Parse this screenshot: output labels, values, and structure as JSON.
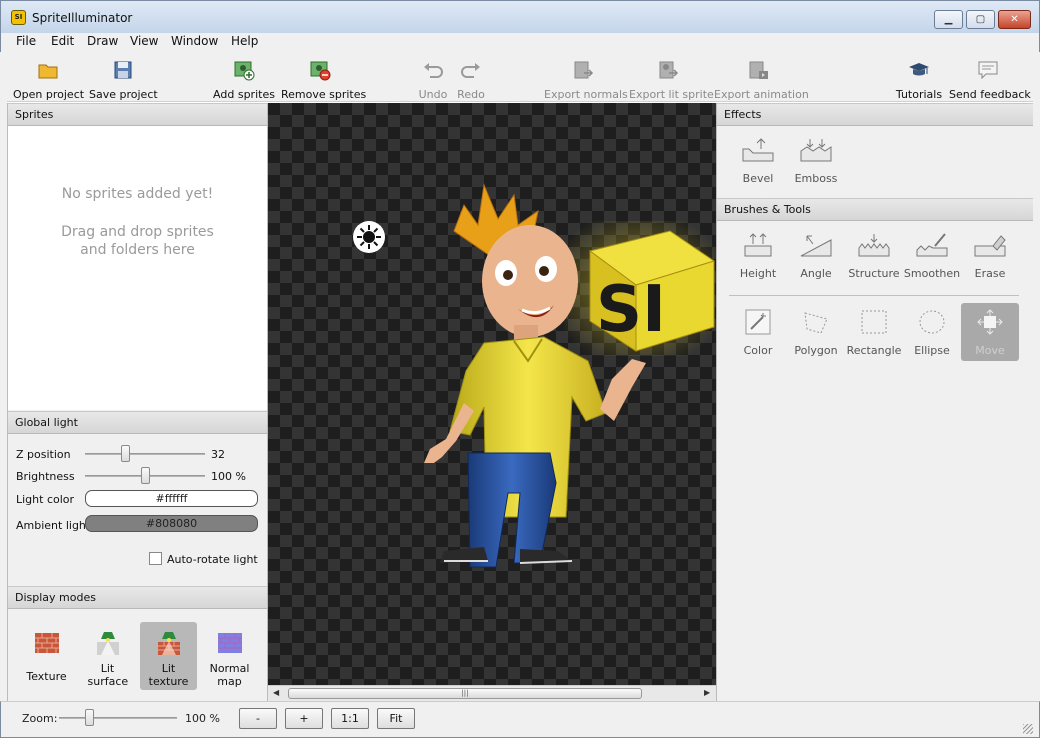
{
  "window": {
    "title": "SpriteIlluminator",
    "icon_text": "SI"
  },
  "menu": [
    "File",
    "Edit",
    "Draw",
    "View",
    "Window",
    "Help"
  ],
  "toolbar": {
    "open_project": "Open project",
    "save_project": "Save project",
    "add_sprites": "Add sprites",
    "remove_sprites": "Remove sprites",
    "undo": "Undo",
    "redo": "Redo",
    "export_normals": "Export normals",
    "export_lit_sprite": "Export lit sprite",
    "export_animation": "Export animation",
    "tutorials": "Tutorials",
    "send_feedback": "Send feedback"
  },
  "sprites": {
    "header": "Sprites",
    "empty_line1": "No sprites added yet!",
    "empty_line2": "Drag and drop sprites and folders here"
  },
  "global_light": {
    "header": "Global light",
    "z_label": "Z position",
    "z_value": "32",
    "z_fraction": 0.33,
    "brightness_label": "Brightness",
    "brightness_value": "100 %",
    "brightness_fraction": 0.5,
    "light_color_label": "Light color",
    "light_color": "#ffffff",
    "ambient_label": "Ambient light",
    "ambient_color": "#808080",
    "autorotate_label": "Auto-rotate light"
  },
  "display_modes": {
    "header": "Display modes",
    "items": [
      "Texture",
      "Lit surface",
      "Lit texture",
      "Normal map"
    ],
    "active_index": 2
  },
  "effects": {
    "header": "Effects",
    "items": [
      "Bevel",
      "Emboss"
    ]
  },
  "brushes": {
    "header": "Brushes & Tools",
    "row1": [
      "Height",
      "Angle",
      "Structure",
      "Smoothen",
      "Erase"
    ],
    "row2": [
      "Color",
      "Polygon",
      "Rectangle",
      "Ellipse",
      "Move"
    ]
  },
  "canvas": {
    "cube_text": "SI"
  },
  "status": {
    "zoom_label": "Zoom:",
    "zoom_value": "100 %",
    "zoom_fraction": 0.25,
    "btn_minus": "-",
    "btn_plus": "+",
    "btn_one": "1:1",
    "btn_fit": "Fit"
  },
  "colors": {
    "accent_yellow": "#f2c200",
    "canvas_dark": "#1e1e1e",
    "active_mode": "#b8b8b8"
  }
}
